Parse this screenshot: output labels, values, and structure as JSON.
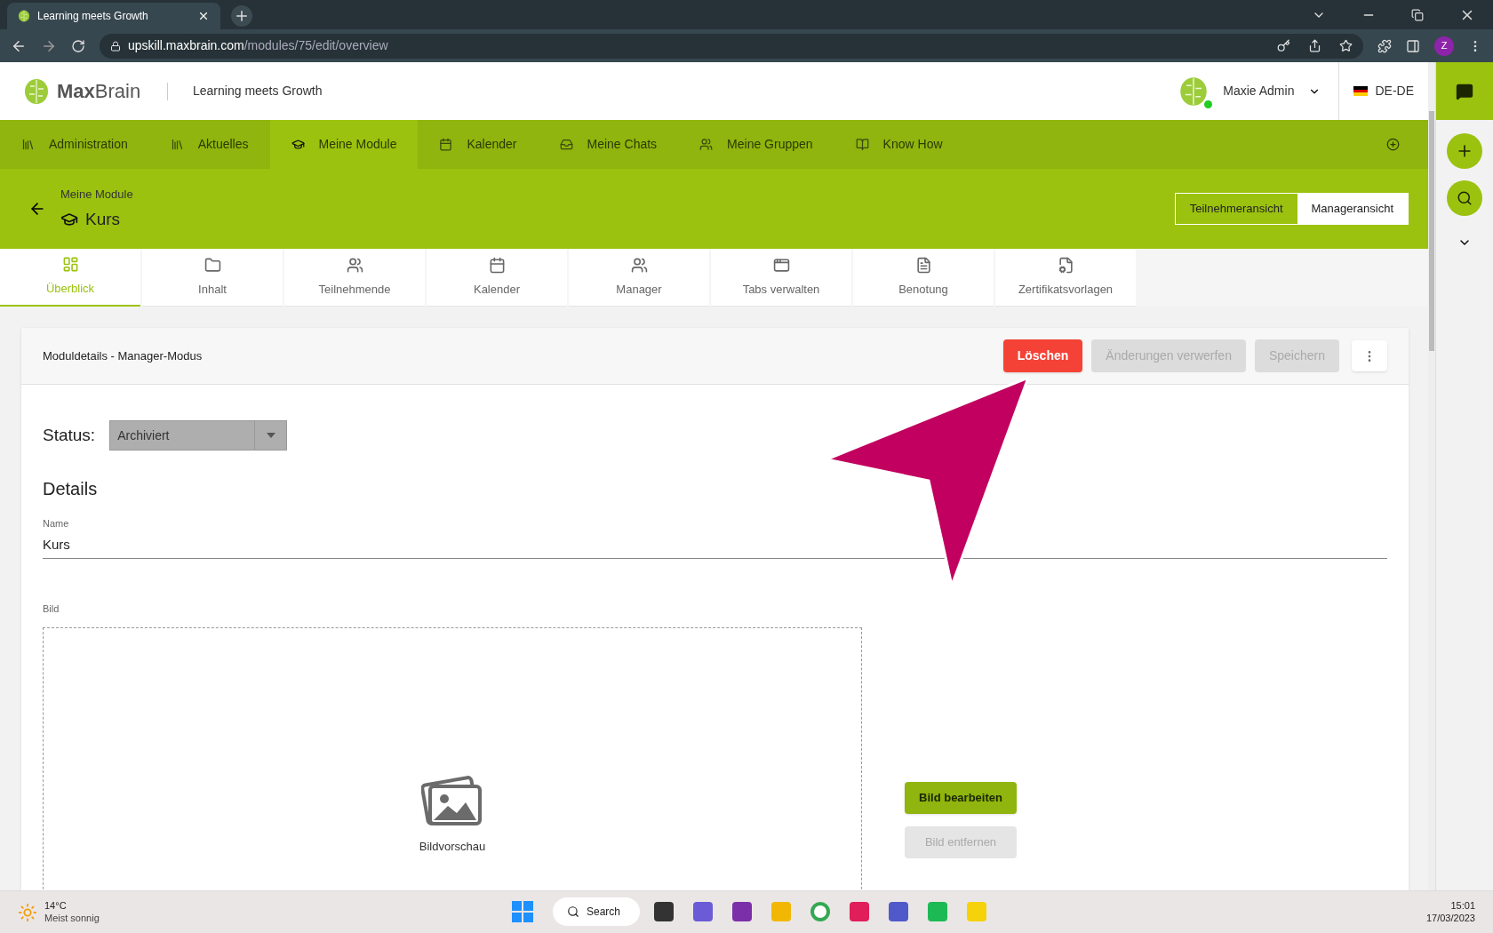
{
  "browser": {
    "tab_title": "Learning meets Growth",
    "url_host": "upskill.maxbrain.com",
    "url_path": "/modules/75/edit/overview",
    "profile_initial": "Z"
  },
  "header": {
    "logo_bold": "Max",
    "logo_light": "Brain",
    "tagline": "Learning meets Growth",
    "user": "Maxie Admin",
    "online": true,
    "language": "DE-DE"
  },
  "nav": [
    {
      "label": "Administration",
      "kind": "library",
      "selected": false
    },
    {
      "label": "Aktuelles",
      "kind": "library",
      "selected": false
    },
    {
      "label": "Meine Module",
      "kind": "school",
      "selected": true
    },
    {
      "label": "Kalender",
      "kind": "calendar",
      "selected": false
    },
    {
      "label": "Meine Chats",
      "kind": "inbox",
      "selected": false
    },
    {
      "label": "Meine Gruppen",
      "kind": "groups",
      "selected": false
    },
    {
      "label": "Know How",
      "kind": "book",
      "selected": false
    }
  ],
  "page": {
    "breadcrumb": "Meine Module",
    "title": "Kurs",
    "views": [
      {
        "label": "Teilnehmeransicht",
        "selected": false
      },
      {
        "label": "Manageransicht",
        "selected": true
      }
    ]
  },
  "tabs": [
    {
      "label": "Überblick",
      "kind": "dashboard",
      "selected": true
    },
    {
      "label": "Inhalt",
      "kind": "folder",
      "selected": false
    },
    {
      "label": "Teilnehmende",
      "kind": "people",
      "selected": false
    },
    {
      "label": "Kalender",
      "kind": "calendar",
      "selected": false
    },
    {
      "label": "Manager",
      "kind": "people",
      "selected": false
    },
    {
      "label": "Tabs verwalten",
      "kind": "window",
      "selected": false
    },
    {
      "label": "Benotung",
      "kind": "grade",
      "selected": false
    },
    {
      "label": "Zertifikatsvorlagen",
      "kind": "filegear",
      "selected": false
    }
  ],
  "card": {
    "title": "Moduldetails - Manager-Modus",
    "actions": [
      {
        "label": "Löschen",
        "kind": "danger",
        "disabled": false
      },
      {
        "label": "Änderungen verwerfen",
        "kind": "plain",
        "disabled": true
      },
      {
        "label": "Speichern",
        "kind": "plain",
        "disabled": true
      }
    ],
    "status_label": "Status:",
    "status_value": "Archiviert",
    "section": "Details",
    "name_label": "Name",
    "name_value": "Kurs",
    "image_label": "Bild",
    "image_preview": "Bildvorschau",
    "image_buttons": [
      {
        "label": "Bild bearbeiten",
        "disabled": false
      },
      {
        "label": "Bild entfernen",
        "disabled": true
      }
    ]
  },
  "taskbar": {
    "temperature": "14°C",
    "weather": "Meist sonnig",
    "search": "Search",
    "time": "15:01",
    "date": "17/03/2023"
  }
}
